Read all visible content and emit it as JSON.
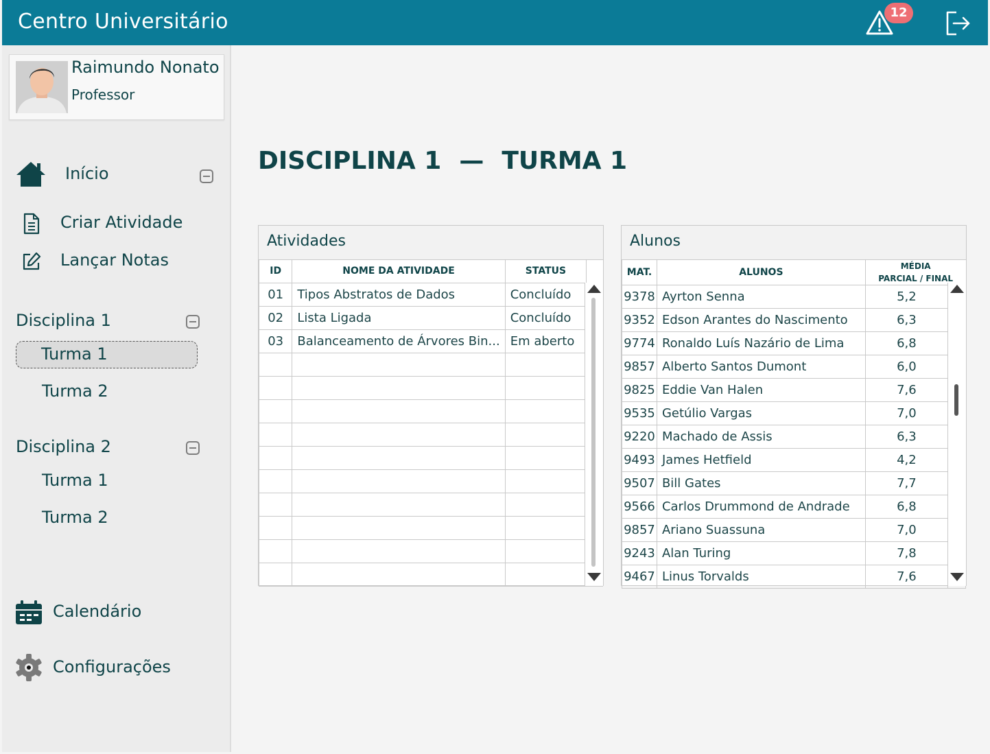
{
  "header": {
    "app_title": "Centro Universitário",
    "alert_count": "12"
  },
  "profile": {
    "name": "Raimundo Nonato",
    "role": "Professor"
  },
  "nav": {
    "inicio": "Início",
    "criar_atividade": "Criar Atividade",
    "lancar_notas": "Lançar Notas",
    "calendario": "Calendário",
    "configuracoes": "Configurações"
  },
  "disciplinas": [
    {
      "label": "Disciplina 1",
      "turmas": [
        "Turma 1",
        "Turma 2"
      ],
      "active_turma": "Turma 1"
    },
    {
      "label": "Disciplina 2",
      "turmas": [
        "Turma 1",
        "Turma 2"
      ]
    }
  ],
  "page": {
    "title_left": "DISCIPLINA 1",
    "title_sep": "—",
    "title_right": "TURMA 1"
  },
  "atividades": {
    "title": "Atividades",
    "columns": [
      "ID",
      "NOME DA ATIVIDADE",
      "STATUS"
    ],
    "rows": [
      {
        "id": "01",
        "nome": "Tipos Abstratos de Dados",
        "status": "Concluído"
      },
      {
        "id": "02",
        "nome": "Lista Ligada",
        "status": "Concluído"
      },
      {
        "id": "03",
        "nome": "Balanceamento de Árvores Bin...",
        "status": "Em aberto"
      }
    ]
  },
  "alunos": {
    "title": "Alunos",
    "columns": [
      "MAT.",
      "ALUNOS",
      "MÉDIA",
      "PARCIAL / FINAL"
    ],
    "rows": [
      {
        "mat": "9378",
        "nome": "Ayrton Senna",
        "media": "5,2"
      },
      {
        "mat": "9352",
        "nome": "Edson Arantes do Nascimento",
        "media": "6,3"
      },
      {
        "mat": "9774",
        "nome": "Ronaldo Luís Nazário de Lima",
        "media": "6,8"
      },
      {
        "mat": "9857",
        "nome": "Alberto Santos Dumont",
        "media": "6,0"
      },
      {
        "mat": "9825",
        "nome": "Eddie Van Halen",
        "media": "7,6"
      },
      {
        "mat": "9535",
        "nome": "Getúlio Vargas",
        "media": "7,0"
      },
      {
        "mat": "9220",
        "nome": "Machado de Assis",
        "media": "6,3"
      },
      {
        "mat": "9493",
        "nome": "James Hetfield",
        "media": "4,2"
      },
      {
        "mat": "9507",
        "nome": "Bill Gates",
        "media": "7,7"
      },
      {
        "mat": "9566",
        "nome": "Carlos Drummond de Andrade",
        "media": "6,8"
      },
      {
        "mat": "9857",
        "nome": "Ariano Suassuna",
        "media": "7,0"
      },
      {
        "mat": "9243",
        "nome": "Alan Turing",
        "media": "7,8"
      },
      {
        "mat": "9467",
        "nome": "Linus Torvalds",
        "media": "7,6"
      }
    ]
  },
  "colors": {
    "header_bg": "#0b7b97",
    "text_primary": "#0f4448",
    "badge_bg": "#ee6f74",
    "sidebar_bg": "#ececec"
  }
}
